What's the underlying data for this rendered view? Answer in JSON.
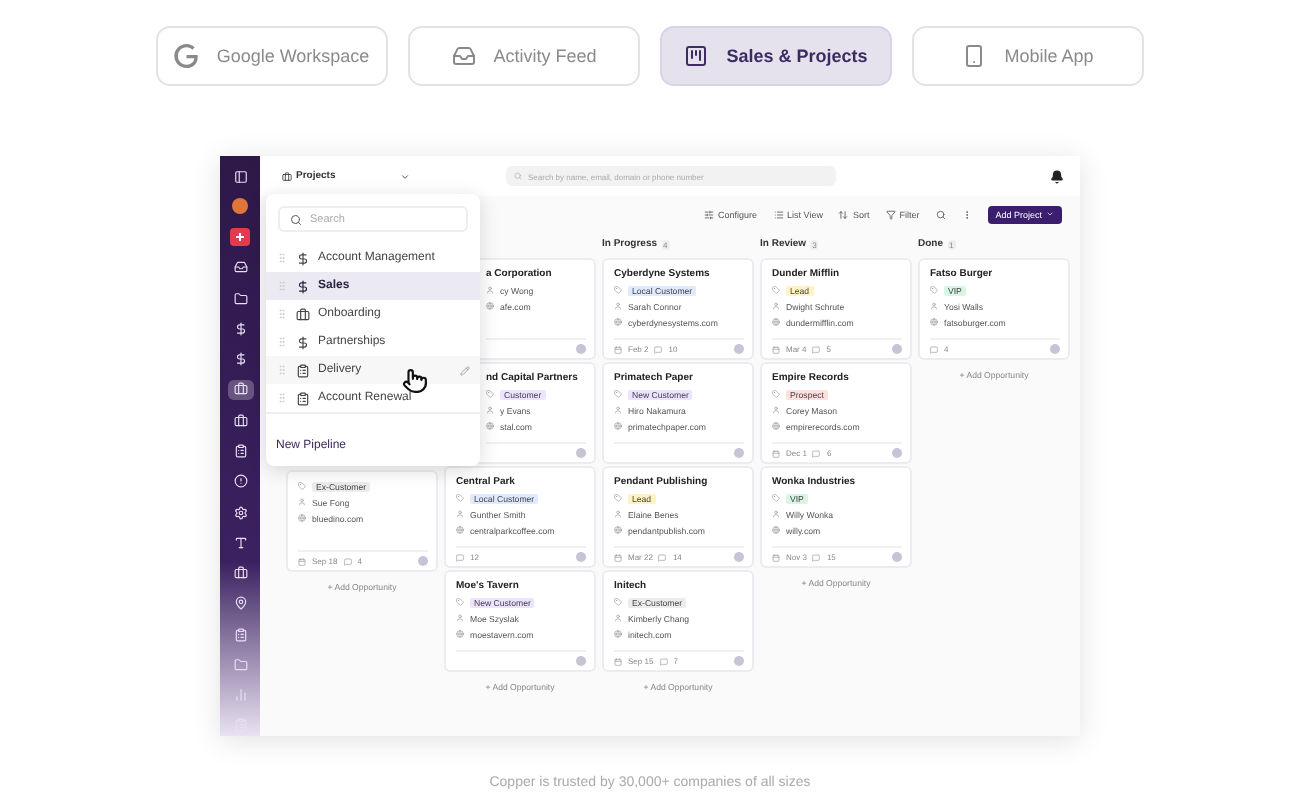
{
  "tabs": [
    {
      "label": "Google Workspace",
      "kind": "google",
      "selected": false
    },
    {
      "label": "Activity Feed",
      "kind": "inbox",
      "selected": false
    },
    {
      "label": "Sales & Projects",
      "kind": "kanban",
      "selected": true
    },
    {
      "label": "Mobile App",
      "kind": "phone",
      "selected": false
    }
  ],
  "sidebar": {
    "items": [
      {
        "kind": "panel",
        "selected": false
      },
      {
        "kind": "avatar",
        "selected": false
      },
      {
        "kind": "plus",
        "selected": false
      },
      {
        "kind": "inbox",
        "selected": false
      },
      {
        "kind": "folder",
        "selected": false
      },
      {
        "kind": "dollar",
        "selected": false
      },
      {
        "kind": "dollar",
        "selected": false
      },
      {
        "kind": "briefcase",
        "selected": true
      },
      {
        "kind": "briefcase",
        "selected": false
      },
      {
        "kind": "clipboard",
        "selected": false
      },
      {
        "kind": "alert",
        "selected": false
      },
      {
        "kind": "gear",
        "selected": false
      },
      {
        "kind": "letter",
        "selected": false
      },
      {
        "kind": "briefcase",
        "selected": false
      },
      {
        "kind": "pin",
        "selected": false
      },
      {
        "kind": "clipboard",
        "selected": false
      },
      {
        "kind": "folder",
        "selected": false
      },
      {
        "kind": "chart",
        "selected": false
      },
      {
        "kind": "clipboard",
        "selected": false
      }
    ]
  },
  "topbar": {
    "pipeline_select": "Projects",
    "search": {
      "placeholder": "Search by name, email, domain or phone number"
    }
  },
  "toolbar": {
    "items": [
      "Configure",
      "List View",
      "Sort",
      "Filter"
    ],
    "primary_button": "Add Project"
  },
  "pipeline_menu": {
    "search": {
      "placeholder": "Search"
    },
    "items": [
      {
        "label": "Account Management",
        "kind": "dollar",
        "selected": false,
        "hovered": false
      },
      {
        "label": "Sales",
        "kind": "dollar",
        "selected": true,
        "hovered": false
      },
      {
        "label": "Onboarding",
        "kind": "briefcase",
        "selected": false,
        "hovered": false
      },
      {
        "label": "Partnerships",
        "kind": "dollar",
        "selected": false,
        "hovered": false
      },
      {
        "label": "Delivery",
        "kind": "clipboard",
        "selected": false,
        "hovered": true
      },
      {
        "label": "Account Renewal",
        "kind": "clipboard",
        "selected": false,
        "hovered": false
      }
    ],
    "footer_link": "New Pipeline"
  },
  "board": {
    "columns": [
      {
        "kind": "under-menu",
        "cards": [
          {
            "kind": "full",
            "tag": {
              "label": "Ex-Customer",
              "color": "#ececec"
            },
            "person": "Sue Fong",
            "domain": "bluedino.com",
            "date": "Sep 18",
            "count": "4"
          }
        ],
        "add_link": "+ Add Opportunity"
      },
      {
        "kind": "partial",
        "cards": [
          {
            "kind": "covered",
            "title": "a Corporation",
            "person": "cy Wong",
            "domain": "afe.com"
          },
          {
            "kind": "covered",
            "title": "nd Capital Partners",
            "tag": {
              "label": "Customer",
              "color": "#ebe3ff"
            },
            "person": "y Evans",
            "domain": "stal.com"
          },
          {
            "kind": "full",
            "title": "Central Park",
            "tag": {
              "label": "Local Customer",
              "color": "#dfe9ff"
            },
            "person": "Gunther Smith",
            "domain": "centralparkcoffee.com",
            "count": "12"
          },
          {
            "kind": "full",
            "title": "Moe's Tavern",
            "tag": {
              "label": "New Customer",
              "color": "#ebe3ff"
            },
            "person": "Moe Szyslak",
            "domain": "moestavern.com"
          }
        ],
        "add_link": "+ Add Opportunity"
      },
      {
        "header": "In Progress",
        "header_count": "4",
        "cards": [
          {
            "kind": "full",
            "title": "Cyberdyne Systems",
            "tag": {
              "label": "Local Customer",
              "color": "#dfe9ff"
            },
            "person": "Sarah Connor",
            "domain": "cyberdynesystems.com",
            "date": "Feb 2",
            "count": "10"
          },
          {
            "kind": "full",
            "title": "Primatech Paper",
            "tag": {
              "label": "New Customer",
              "color": "#ebe3ff"
            },
            "person": "Hiro Nakamura",
            "domain": "primatechpaper.com"
          },
          {
            "kind": "full",
            "title": "Pendant Publishing",
            "tag": {
              "label": "Lead",
              "color": "#fff3c4"
            },
            "person": "Elaine Benes",
            "domain": "pendantpublish.com",
            "date": "Mar 22",
            "count": "14"
          },
          {
            "kind": "full",
            "title": "Initech",
            "tag": {
              "label": "Ex-Customer",
              "color": "#ececec"
            },
            "person": "Kimberly Chang",
            "domain": "initech.com",
            "date": "Sep 15",
            "count": "7"
          }
        ],
        "add_link": "+ Add Opportunity"
      },
      {
        "header": "In Review",
        "header_count": "3",
        "cards": [
          {
            "kind": "full",
            "title": "Dunder Mifflin",
            "tag": {
              "label": "Lead",
              "color": "#fff3c4"
            },
            "person": "Dwight Schrute",
            "domain": "dundermifflin.com",
            "date": "Mar 4",
            "count": "5"
          },
          {
            "kind": "full",
            "title": "Empire Records",
            "tag": {
              "label": "Prospect",
              "color": "#ffe0e0"
            },
            "person": "Corey Mason",
            "domain": "empirerecords.com",
            "date": "Dec 1",
            "count": "6"
          },
          {
            "kind": "full",
            "title": "Wonka Industries",
            "tag": {
              "label": "VIP",
              "color": "#d8f6e3"
            },
            "person": "Willy Wonka",
            "domain": "willy.com",
            "date": "Nov 3",
            "count": "15"
          }
        ],
        "add_link": "+ Add Opportunity"
      },
      {
        "header": "Done",
        "header_count": "1",
        "cards": [
          {
            "kind": "full",
            "title": "Fatso Burger",
            "tag": {
              "label": "VIP",
              "color": "#d8f6e3"
            },
            "person": "Yosi Walls",
            "domain": "fatsoburger.com",
            "count": "4"
          }
        ],
        "add_link": "+ Add Opportunity"
      }
    ]
  },
  "caption": "Copper is trusted by 30,000+ companies of all sizes"
}
